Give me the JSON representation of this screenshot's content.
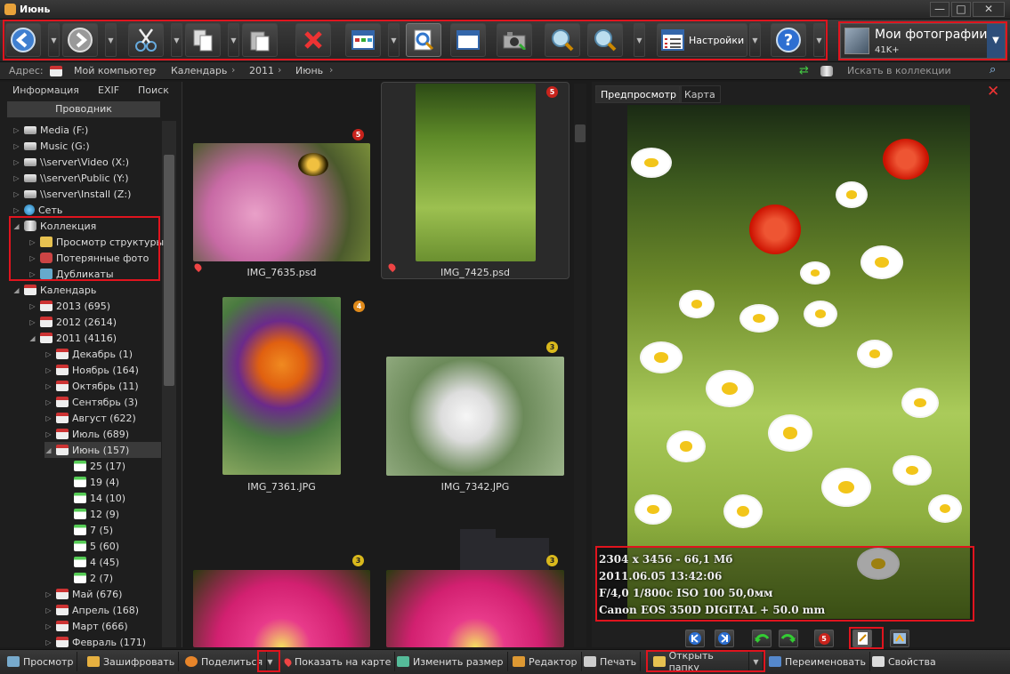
{
  "window": {
    "title": "Июнь",
    "minimize": "—",
    "maximize": "□",
    "close": "✕"
  },
  "toolbar": {
    "settings_label": "Настройки",
    "collection": {
      "name": "Мои фотографии",
      "count": "41K+"
    }
  },
  "address": {
    "label": "Адрес:",
    "crumbs": [
      "Мой компьютер",
      "Календарь",
      "2011",
      "Июнь"
    ],
    "search_placeholder": "Искать в коллекции"
  },
  "left": {
    "tabs": [
      "Информация",
      "EXIF",
      "Поиск"
    ],
    "explorer_header": "Проводник",
    "tree": [
      "Media (F:)",
      "Music (G:)",
      "\\\\server\\Video (X:)",
      "\\\\server\\Public (Y:)",
      "\\\\server\\Install (Z:)",
      "Сеть",
      "Коллекция",
      "Просмотр структуры",
      "Потерянные фото",
      "Дубликаты",
      "Календарь",
      "2013 (695)",
      "2012 (2614)",
      "2011 (4116)",
      "Декабрь (1)",
      "Ноябрь (164)",
      "Октябрь (11)",
      "Сентябрь (3)",
      "Август (622)",
      "Июль (689)",
      "Июнь (157)",
      "25 (17)",
      "19 (4)",
      "14 (10)",
      "12 (9)",
      "7 (5)",
      "5 (60)",
      "4 (45)",
      "2 (7)",
      "Май (676)",
      "Апрель (168)",
      "Март (666)",
      "Февраль (171)"
    ]
  },
  "thumbs": [
    {
      "name": "IMG_7635.psd",
      "badge": "5"
    },
    {
      "name": "IMG_7425.psd",
      "badge": "5"
    },
    {
      "name": "IMG_7361.JPG",
      "badge": "4"
    },
    {
      "name": "IMG_7342.JPG",
      "badge": "3"
    },
    {
      "name": "",
      "badge": "3"
    },
    {
      "name": "",
      "badge": "3"
    }
  ],
  "right": {
    "tabs": [
      "Предпросмотр",
      "Карта"
    ],
    "exif": [
      "2304 x 3456 - 66,1 Мб",
      "2011.06.05 13:42:06",
      "F/4,0  1/800с  ISO 100  50,0мм",
      "Canon EOS 350D DIGITAL + 50.0 mm"
    ],
    "rating_badge": "5"
  },
  "status": [
    "Просмотр",
    "Зашифровать",
    "Поделиться",
    "Показать на карте",
    "Изменить размер",
    "Редактор",
    "Печать",
    "Открыть папку",
    "Переименовать",
    "Свойства"
  ],
  "colors": {
    "highlight": "#e0141e",
    "accent_blue": "#2d4e7a",
    "badge_red": "#c8231c",
    "badge_orange": "#e08a1a",
    "badge_yellow": "#d9b81c"
  }
}
